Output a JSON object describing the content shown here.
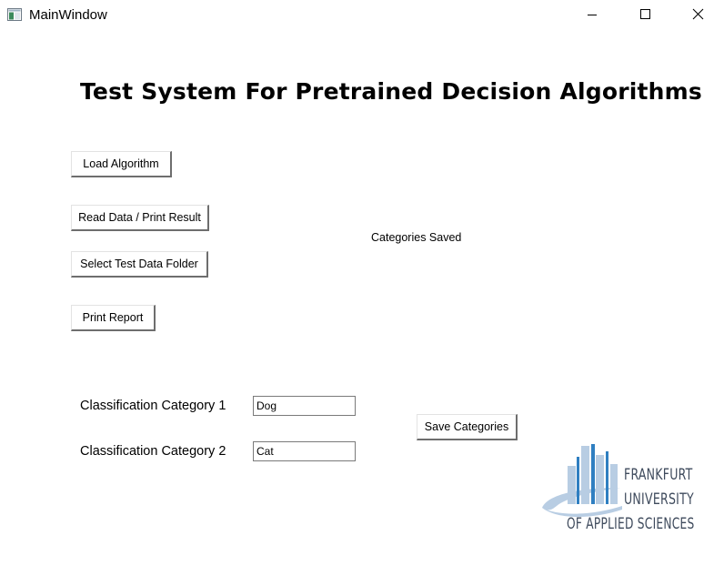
{
  "window": {
    "title": "MainWindow",
    "controls": [
      "minimize-icon",
      "maximize-icon",
      "close-icon"
    ]
  },
  "main": {
    "heading": "Test System For Pretrained Decision Algorithms",
    "buttons": {
      "load_algorithm": "Load Algorithm",
      "read_data": "Read Data / Print Result",
      "select_folder": "Select Test Data Folder",
      "print_report": "Print Report",
      "save_categories": "Save Categories"
    },
    "status_text": "Categories Saved",
    "categories": [
      {
        "label": "Classification Category 1",
        "value": "Dog"
      },
      {
        "label": "Classification Category 2",
        "value": "Cat"
      }
    ]
  },
  "logo": {
    "line1": "FRANKFURT",
    "line2": "UNIVERSITY",
    "line3": "OF APPLIED SCIENCES",
    "colors": {
      "bars_light": "#b8cde3",
      "bars_dark": "#2f7fc1",
      "text": "#3e4a5c"
    }
  }
}
